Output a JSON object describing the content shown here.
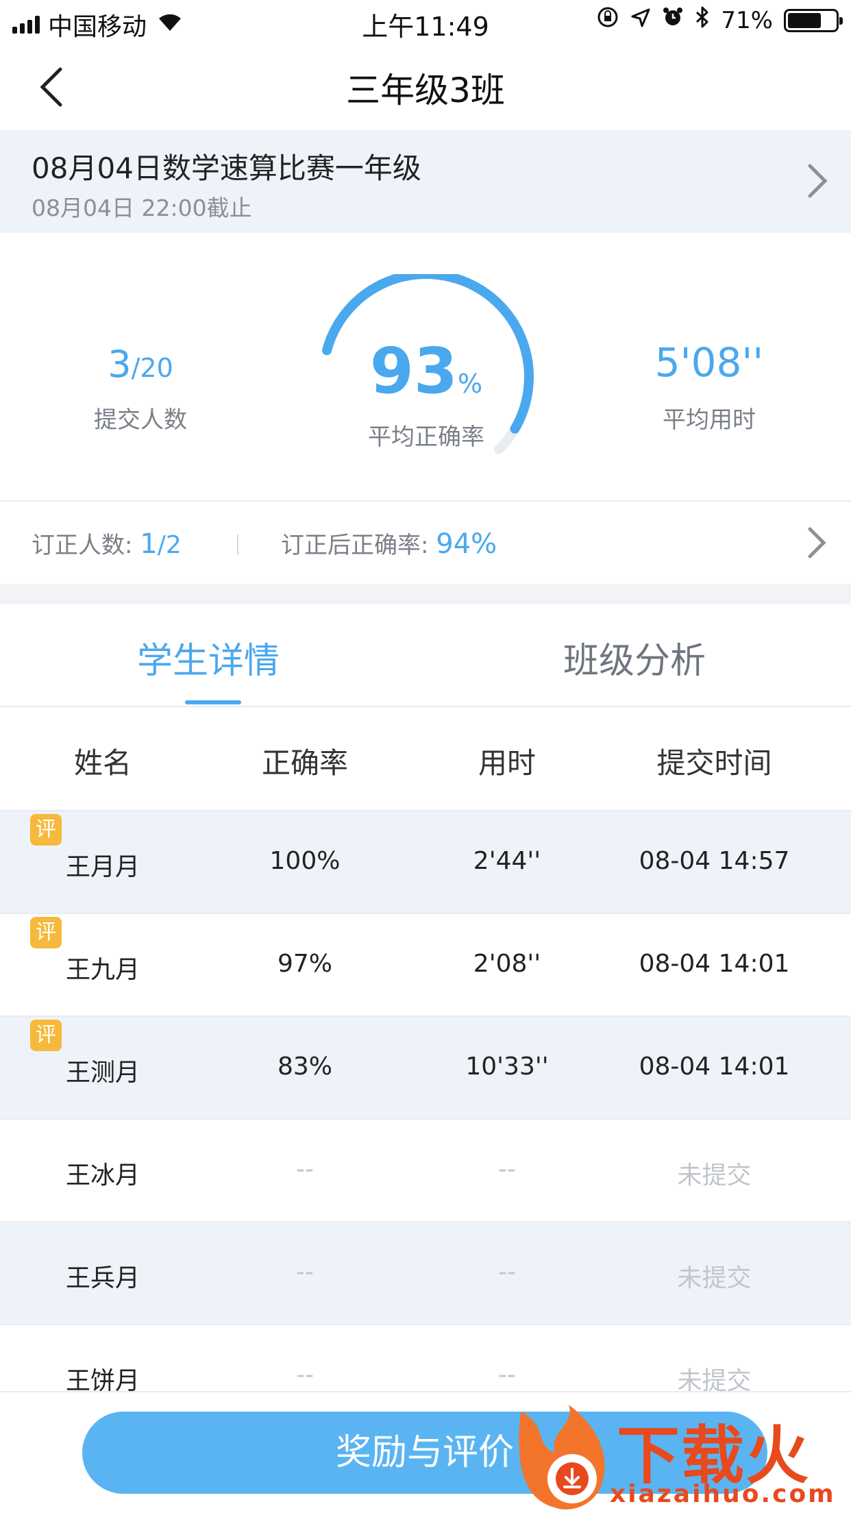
{
  "status_bar": {
    "carrier": "中国移动",
    "time": "上午11:49",
    "battery_text": "71%",
    "battery_level": 0.71
  },
  "nav": {
    "title": "三年级3班"
  },
  "competition": {
    "title": "08月04日数学速算比赛一年级",
    "deadline": "08月04日 22:00截止"
  },
  "stats": {
    "submitted": {
      "num": "3",
      "total": "/20",
      "label": "提交人数"
    },
    "accuracy": {
      "num": "93",
      "unit": "%",
      "label": "平均正确率",
      "value": 0.93
    },
    "avg_time": {
      "value": "5'08''",
      "label": "平均用时"
    }
  },
  "correction": {
    "count_label": "订正人数:",
    "count_num": "1",
    "count_total": "/2",
    "rate_label": "订正后正确率:",
    "rate_value": "94%"
  },
  "tabs": [
    {
      "label": "学生详情",
      "active": true
    },
    {
      "label": "班级分析",
      "active": false
    }
  ],
  "table": {
    "headers": [
      "姓名",
      "正确率",
      "用时",
      "提交时间"
    ],
    "badge_label": "评",
    "rows": [
      {
        "name": "王月月",
        "accuracy": "100%",
        "time": "2'44''",
        "submitted": "08-04 14:57",
        "badge": true
      },
      {
        "name": "王九月",
        "accuracy": "97%",
        "time": "2'08''",
        "submitted": "08-04 14:01",
        "badge": true
      },
      {
        "name": "王测月",
        "accuracy": "83%",
        "time": "10'33''",
        "submitted": "08-04 14:01",
        "badge": true
      },
      {
        "name": "王冰月",
        "accuracy": "--",
        "time": "--",
        "submitted": "未提交",
        "badge": false
      },
      {
        "name": "王兵月",
        "accuracy": "--",
        "time": "--",
        "submitted": "未提交",
        "badge": false
      },
      {
        "name": "王饼月",
        "accuracy": "--",
        "time": "--",
        "submitted": "未提交",
        "badge": false
      }
    ]
  },
  "bottom": {
    "button_label": "奖励与评价"
  },
  "watermark": {
    "name": "下载火",
    "url": "xiazaihuo.com"
  },
  "colors": {
    "accent": "#4aa8ee",
    "button": "#5ab4f2",
    "badge": "#f6b93b",
    "watermark": "#e8491d"
  }
}
